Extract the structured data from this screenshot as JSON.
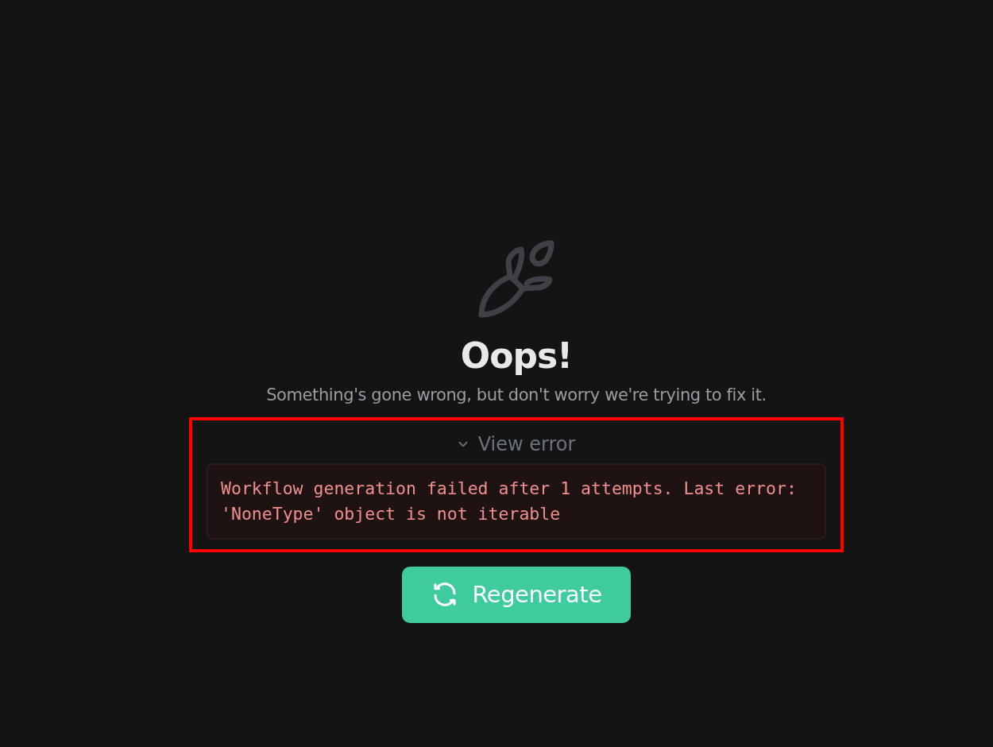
{
  "title": "Oops!",
  "message": "Something's gone wrong, but don't worry we're trying to fix it.",
  "error": {
    "toggle_label": "View error",
    "expanded": true,
    "highlighted": true,
    "text": "Workflow generation failed after 1 attempts. Last error: 'NoneType' object is not iterable"
  },
  "button": {
    "label": "Regenerate"
  }
}
